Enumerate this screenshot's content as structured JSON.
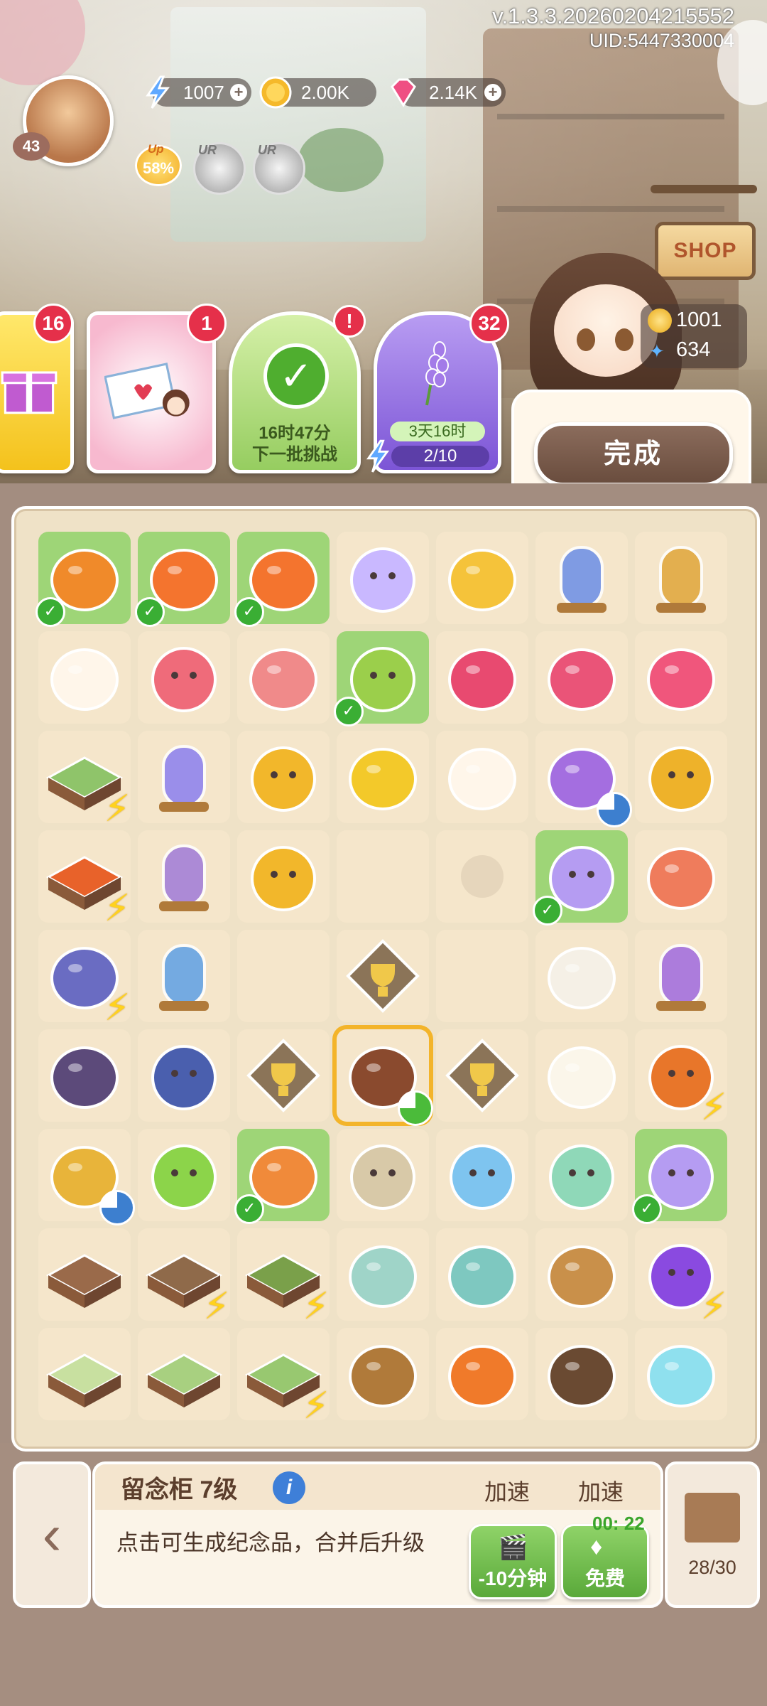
{
  "header": {
    "version": "v.1.3.3.20260204215552",
    "uid": "UID:5447330004",
    "player_level": "43",
    "resources": {
      "energy": "1007",
      "coins": "2.00K",
      "gems": "2.14K"
    },
    "up_badge": {
      "tag": "Up",
      "value": "58%"
    },
    "ur_coins": [
      "UR",
      "UR"
    ]
  },
  "shop": {
    "label": "SHOP"
  },
  "events": {
    "gift": {
      "badge": "16"
    },
    "mail": {
      "badge": "1"
    },
    "challenge": {
      "badge": "!",
      "time": "16时47分",
      "label": "下一批挑战"
    },
    "lavender": {
      "badge": "32",
      "time": "3天16时",
      "progress": "2/10"
    }
  },
  "npc": {
    "coins": "1001",
    "butterflies": "634",
    "done_label": "完成"
  },
  "board": {
    "rows": [
      [
        {
          "icon": "orange-flower",
          "hl": true,
          "tick": true
        },
        {
          "icon": "goldfish",
          "hl": true,
          "tick": true
        },
        {
          "icon": "goldfish",
          "hl": true,
          "tick": true
        },
        {
          "icon": "rainbow-crystal"
        },
        {
          "icon": "pineapple"
        },
        {
          "icon": "blue-tree-jar"
        },
        {
          "icon": "golden-tree-jar"
        }
      ],
      [
        {
          "icon": "white-magnolia"
        },
        {
          "icon": "red-drop"
        },
        {
          "icon": "koi-fish"
        },
        {
          "icon": "green-pear",
          "hl": true,
          "tick": true
        },
        {
          "icon": "ruby-pile"
        },
        {
          "icon": "ruby-pair"
        },
        {
          "icon": "ruby"
        }
      ],
      [
        {
          "icon": "garden-bridge",
          "bolt": true
        },
        {
          "icon": "lavender-jar"
        },
        {
          "icon": "gold-coin"
        },
        {
          "icon": "yellow-flower"
        },
        {
          "icon": "white-magnolia"
        },
        {
          "icon": "purple-potion",
          "timer": "blue"
        },
        {
          "icon": "coin-stack"
        }
      ],
      [
        {
          "icon": "flower-planter",
          "bolt": true
        },
        {
          "icon": "star-flower-jar"
        },
        {
          "icon": "two-coins"
        },
        {
          "icon": "empty"
        },
        {
          "icon": "locked-flower"
        },
        {
          "icon": "purple-drop",
          "hl": true,
          "tick": true
        },
        {
          "icon": "betta-fish"
        }
      ],
      [
        {
          "icon": "teapot",
          "bolt": true
        },
        {
          "icon": "blue-plant-jar"
        },
        {
          "icon": "empty"
        },
        {
          "icon": "trophy-diamond"
        },
        {
          "icon": "empty"
        },
        {
          "icon": "calla-lily"
        },
        {
          "icon": "purple-tree-jar"
        }
      ],
      [
        {
          "icon": "flower-book"
        },
        {
          "icon": "wave-gear"
        },
        {
          "icon": "trophy-diamond"
        },
        {
          "icon": "cabinet",
          "timer": "green",
          "selected": true
        },
        {
          "icon": "trophy-diamond"
        },
        {
          "icon": "calla-bloom"
        },
        {
          "icon": "fire-swirl",
          "bolt": true
        }
      ],
      [
        {
          "icon": "perfume-bottle",
          "timer": "blue"
        },
        {
          "icon": "green-blob"
        },
        {
          "icon": "clownfish",
          "hl": true,
          "tick": true
        },
        {
          "icon": "maple-gear"
        },
        {
          "icon": "blue-drop"
        },
        {
          "icon": "green-drop"
        },
        {
          "icon": "purple-drop",
          "hl": true,
          "tick": true
        }
      ],
      [
        {
          "icon": "soil-plot"
        },
        {
          "icon": "sprout-plot",
          "bolt": true
        },
        {
          "icon": "bush-plot",
          "bolt": true
        },
        {
          "icon": "glass-vase"
        },
        {
          "icon": "teal-bottle"
        },
        {
          "icon": "wood-table"
        },
        {
          "icon": "purple-swirl",
          "bolt": true
        }
      ],
      [
        {
          "icon": "pergola"
        },
        {
          "icon": "vine-pergola"
        },
        {
          "icon": "arch-pergola",
          "bolt": true
        },
        {
          "icon": "log-pile"
        },
        {
          "icon": "campfire"
        },
        {
          "icon": "tree-stump"
        },
        {
          "icon": "ice-shards"
        }
      ]
    ]
  },
  "panel": {
    "title": "留念柜 7级",
    "speed1_label": "加速",
    "speed2_label": "加速",
    "description": "点击可生成纪念品，合并后升级",
    "btn_ad_label": "-10分钟",
    "btn_free_label": "免费",
    "countdown": "00: 22",
    "box_count": "28/30"
  },
  "colors": {
    "board_bg": "#efe2c7",
    "cell_bg": "#f5e6cb",
    "cell_highlight": "#9ed577",
    "tick_green": "#3aae34",
    "badge_red": "#e5304a"
  }
}
